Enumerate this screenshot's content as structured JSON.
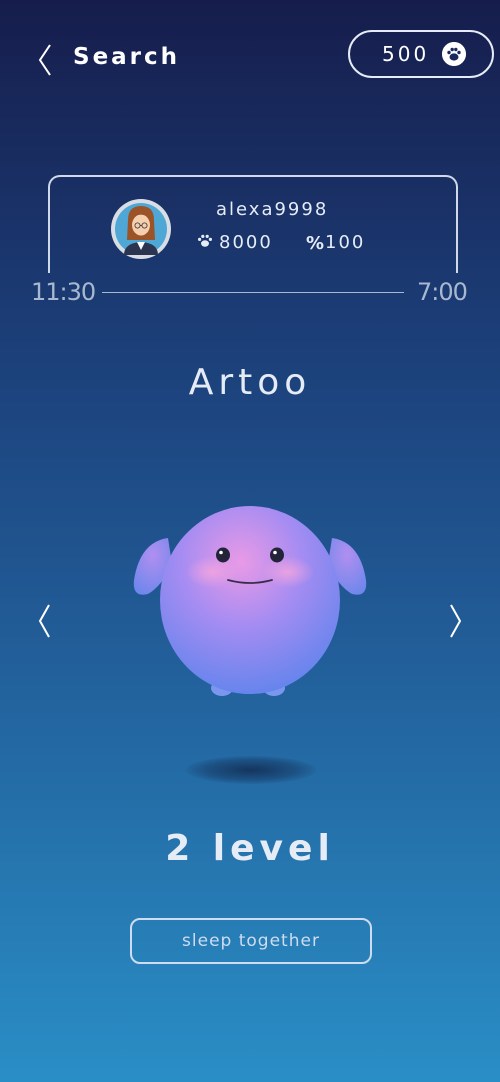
{
  "header": {
    "back_icon": "chevron-left-icon",
    "title": "Search",
    "coins": "500",
    "coin_icon": "paw-icon"
  },
  "user_card": {
    "username": "alexa9998",
    "paw_points": "8000",
    "percent_icon": "%",
    "percent_value": "100",
    "avatar_icon": "user-avatar-icon"
  },
  "schedule": {
    "start_time": "11:30",
    "end_time": "7:00"
  },
  "pet": {
    "name": "Artoo",
    "level": "2 level",
    "prev_icon": "chevron-left-icon",
    "next_icon": "chevron-right-icon"
  },
  "action": {
    "label": "sleep together"
  },
  "colors": {
    "background_top": "#161d4c",
    "background_bottom": "#2a8ec6",
    "text": "#e6ecf6",
    "creature": "#8f8cf2"
  }
}
